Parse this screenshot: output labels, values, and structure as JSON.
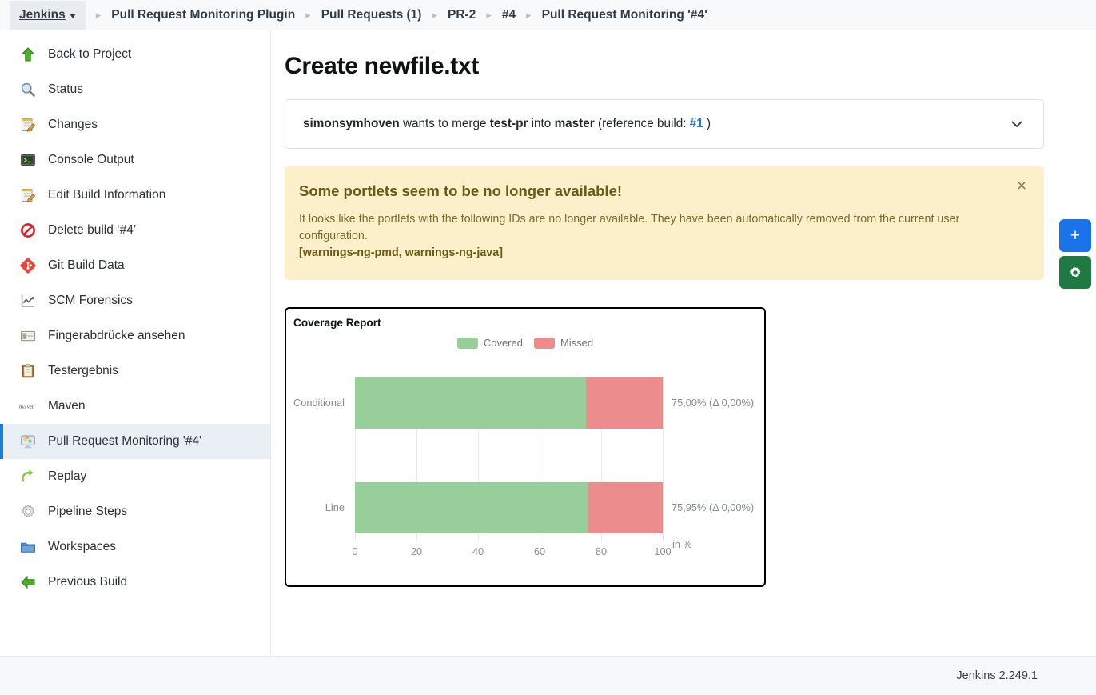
{
  "breadcrumb": {
    "root_label": "Jenkins",
    "items": [
      {
        "label": "Pull Request Monitoring Plugin"
      },
      {
        "label": "Pull Requests (1)"
      },
      {
        "label": "PR-2"
      },
      {
        "label": "#4"
      },
      {
        "label": "Pull Request Monitoring '#4'"
      }
    ],
    "separator": "▸"
  },
  "sidebar": {
    "items": [
      {
        "label": "Back to Project",
        "icon": "up-arrow-icon"
      },
      {
        "label": "Status",
        "icon": "magnifier-icon"
      },
      {
        "label": "Changes",
        "icon": "notepad-pencil-icon"
      },
      {
        "label": "Console Output",
        "icon": "terminal-icon"
      },
      {
        "label": "Edit Build Information",
        "icon": "notepad-pencil-icon"
      },
      {
        "label": "Delete build ‘#4’",
        "icon": "no-entry-icon"
      },
      {
        "label": "Git Build Data",
        "icon": "git-icon"
      },
      {
        "label": "SCM Forensics",
        "icon": "trend-chart-icon"
      },
      {
        "label": "Fingerabdrücke ansehen",
        "icon": "fingerprint-card-icon"
      },
      {
        "label": "Testergebnis",
        "icon": "clipboard-icon"
      },
      {
        "label": "Maven",
        "icon": "maven-icon"
      },
      {
        "label": "Pull Request Monitoring '#4'",
        "icon": "monitor-icon",
        "active": true
      },
      {
        "label": "Replay",
        "icon": "replay-arrow-icon"
      },
      {
        "label": "Pipeline Steps",
        "icon": "gear-icon"
      },
      {
        "label": "Workspaces",
        "icon": "folder-icon"
      },
      {
        "label": "Previous Build",
        "icon": "left-arrow-icon"
      }
    ]
  },
  "main": {
    "page_title": "Create newfile.txt",
    "pr_summary": {
      "author": "simonsymhoven",
      "verb": " wants to merge ",
      "source_branch": "test-pr",
      "into": " into ",
      "target_branch": "master",
      "reference_prefix": " (reference build: ",
      "reference_build": "#1",
      "reference_suffix": " )"
    },
    "warning": {
      "title": "Some portlets seem to be no longer available!",
      "body": "It looks like the portlets with the following IDs are no longer available. They have been automatically removed from the current user configuration.",
      "ids": "[warnings-ng-pmd, warnings-ng-java]",
      "close_label": "×"
    }
  },
  "chart_data": {
    "type": "bar",
    "orientation": "horizontal",
    "stacked": true,
    "title": "Coverage Report",
    "categories": [
      "Conditional",
      "Line"
    ],
    "series": [
      {
        "name": "Covered",
        "values": [
          75.0,
          75.95
        ],
        "color": "#97ce9a"
      },
      {
        "name": "Missed",
        "values": [
          25.0,
          24.05
        ],
        "color": "#ec8c8c"
      }
    ],
    "bar_value_labels": [
      "75,00% (Δ 0,00%)",
      "75,95% (Δ 0,00%)"
    ],
    "xlabel": "in %",
    "ylabel": "",
    "xlim": [
      0,
      100
    ],
    "xticks": [
      0,
      20,
      40,
      60,
      80,
      100
    ],
    "xtick_labels": [
      "0",
      "20",
      "40",
      "60",
      "80",
      "100"
    ],
    "grid": true,
    "legend_position": "top-center",
    "legend": [
      "Covered",
      "Missed"
    ]
  },
  "fab": {
    "add_label": "+",
    "settings_label": "⚙"
  },
  "footer": {
    "version": "Jenkins 2.249.1"
  },
  "colors": {
    "covered": "#97ce9a",
    "missed": "#ec8c8c",
    "accent_blue": "#1a73e8",
    "accent_green": "#1e7a42",
    "warning_bg": "#fcf0cb",
    "link": "#1f6feb"
  }
}
